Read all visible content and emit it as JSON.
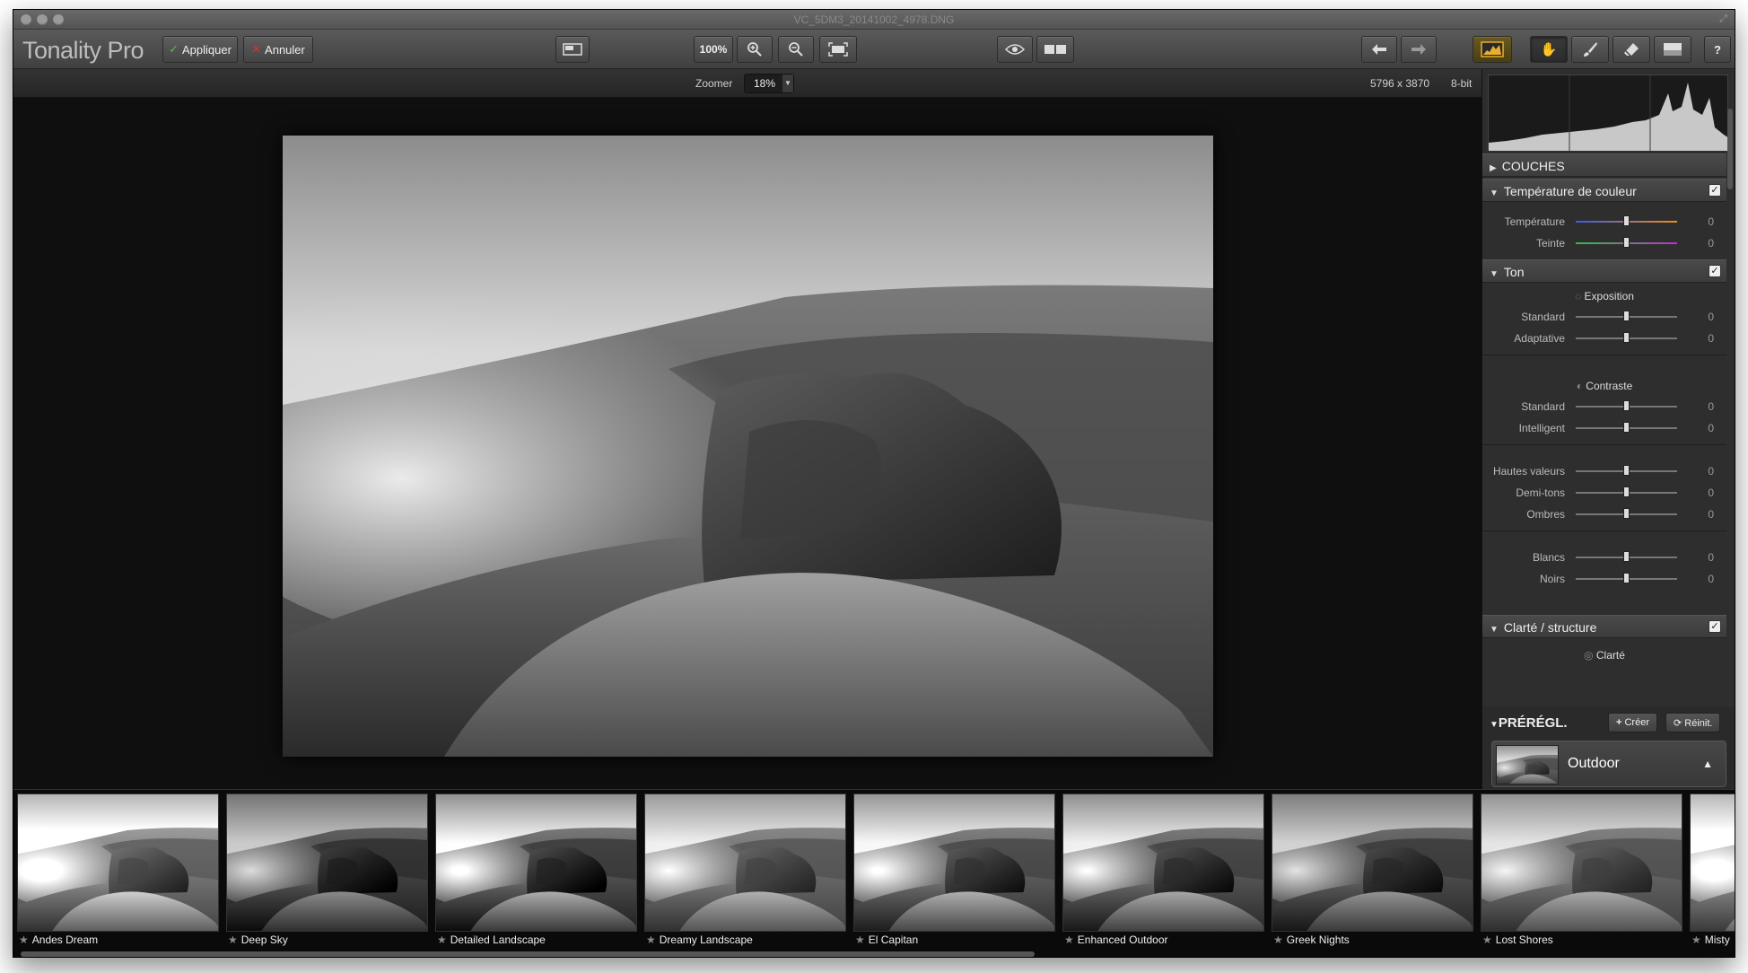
{
  "window": {
    "title": "VC_5DM3_20141002_4978.DNG"
  },
  "toolbar": {
    "app_name": "Tonality Pro",
    "apply_label": "Appliquer",
    "cancel_label": "Annuler",
    "zoom_100_label": "100%",
    "help_label": "?"
  },
  "infobar": {
    "zoom_label": "Zoomer",
    "zoom_value": "18%",
    "dimensions": "5796 x 3870",
    "bit_depth": "8-bit"
  },
  "panel": {
    "layers_title": "COUCHES",
    "color_temp": {
      "title": "Température de couleur",
      "checked": true,
      "sliders": [
        {
          "label": "Température",
          "value": "0"
        },
        {
          "label": "Teinte",
          "value": "0"
        }
      ]
    },
    "tone": {
      "title": "Ton",
      "checked": true,
      "exposure_label": "Exposition",
      "exposure_sliders": [
        {
          "label": "Standard",
          "value": "0"
        },
        {
          "label": "Adaptative",
          "value": "0"
        }
      ],
      "contrast_label": "Contraste",
      "contrast_sliders": [
        {
          "label": "Standard",
          "value": "0"
        },
        {
          "label": "Intelligent",
          "value": "0"
        }
      ],
      "range_sliders": [
        {
          "label": "Hautes valeurs",
          "value": "0"
        },
        {
          "label": "Demi-tons",
          "value": "0"
        },
        {
          "label": "Ombres",
          "value": "0"
        }
      ],
      "point_sliders": [
        {
          "label": "Blancs",
          "value": "0"
        },
        {
          "label": "Noirs",
          "value": "0"
        }
      ]
    },
    "clarity": {
      "title": "Clarté / structure",
      "checked": true,
      "sub_label": "Clarté"
    },
    "presets": {
      "title": "PRÉRÉGL.",
      "create_label": "Créer",
      "reset_label": "Réinit.",
      "selected": "Outdoor"
    }
  },
  "filmstrip": {
    "items": [
      {
        "name": "Andes Dream"
      },
      {
        "name": "Deep Sky"
      },
      {
        "name": "Detailed Landscape"
      },
      {
        "name": "Dreamy Landscape"
      },
      {
        "name": "El Capitan"
      },
      {
        "name": "Enhanced Outdoor"
      },
      {
        "name": "Greek Nights"
      },
      {
        "name": "Lost Shores"
      },
      {
        "name": "Misty"
      }
    ]
  },
  "colors": {
    "window_bg": "#151515",
    "panel_bg": "#2e2e2e",
    "apply_check": "#52c04a",
    "cancel_cross": "#e03030",
    "histogram_fill": "#c8c8c8"
  }
}
